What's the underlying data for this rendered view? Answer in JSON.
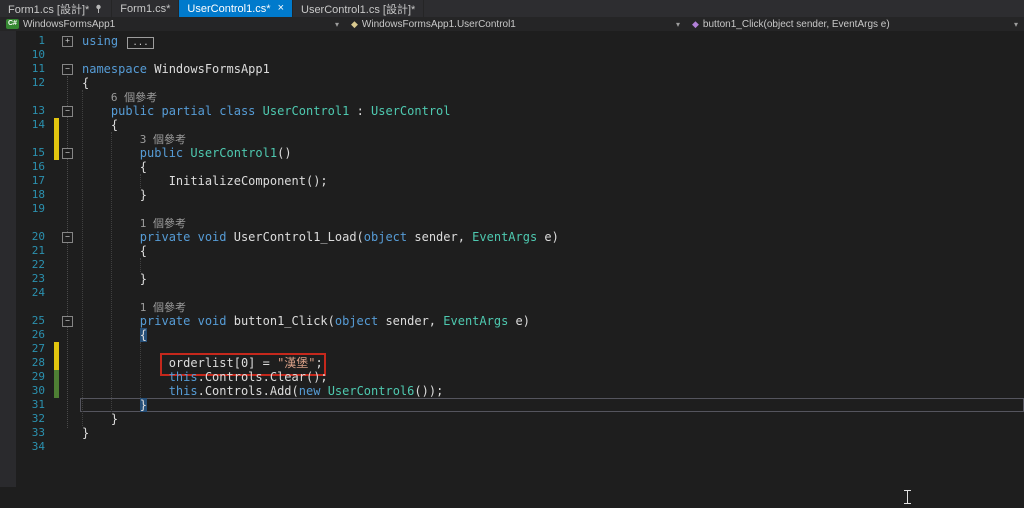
{
  "tabs": [
    {
      "label": "Form1.cs [設計]*",
      "state": "inactive",
      "pinned": true
    },
    {
      "label": "Form1.cs*",
      "state": "inactive"
    },
    {
      "label": "UserControl1.cs*",
      "state": "active",
      "closable": true
    },
    {
      "label": "UserControl1.cs [設計]*",
      "state": "inactive"
    }
  ],
  "navbar": {
    "project": "WindowsFormsApp1",
    "type": "WindowsFormsApp1.UserControl1",
    "member": "button1_Click(object sender, EventArgs e)"
  },
  "icons": {
    "close": "×",
    "chevron": "▾",
    "project": "C#",
    "class": "◆",
    "method": "◆",
    "collapse": "−",
    "expand": "+"
  },
  "colors": {
    "accent": "#007ACC",
    "background": "#1E1E1E",
    "keyword": "#569CD6",
    "type": "#4EC9B0",
    "string": "#D69D85",
    "text": "#DCDCDC",
    "line_number": "#2B91AF",
    "codelens": "#9D9D9D",
    "change_unsaved": "#E2C50F",
    "change_saved": "#4E7F34",
    "annotation_red": "#C5281C",
    "brace_match": "#264F78"
  },
  "editor": {
    "rows": [
      {
        "n": "1",
        "fold": "+",
        "segs": [
          [
            "k",
            "using"
          ],
          [
            "p",
            " "
          ],
          [
            "dots",
            "..."
          ]
        ]
      },
      {
        "n": "10",
        "segs": []
      },
      {
        "n": "11",
        "fold": "-",
        "segs": [
          [
            "k",
            "namespace"
          ],
          [
            "p",
            " WindowsFormsApp1"
          ]
        ]
      },
      {
        "n": "12",
        "segs": [
          [
            "p",
            "{"
          ]
        ]
      },
      {
        "lens": "6 個參考",
        "col": 4
      },
      {
        "n": "13",
        "fold": "-",
        "segs": [
          [
            "p",
            "    "
          ],
          [
            "k",
            "public partial class"
          ],
          [
            "p",
            " "
          ],
          [
            "t",
            "UserControl1"
          ],
          [
            "p",
            " : "
          ],
          [
            "t",
            "UserControl"
          ]
        ]
      },
      {
        "n": "14",
        "change": "y",
        "segs": [
          [
            "p",
            "    {"
          ]
        ]
      },
      {
        "lens": "3 個參考",
        "col": 8,
        "change": "y"
      },
      {
        "n": "15",
        "fold": "-",
        "change": "y",
        "segs": [
          [
            "p",
            "        "
          ],
          [
            "k",
            "public"
          ],
          [
            "p",
            " "
          ],
          [
            "t",
            "UserControl1"
          ],
          [
            "p",
            "()"
          ]
        ]
      },
      {
        "n": "16",
        "segs": [
          [
            "p",
            "        {"
          ]
        ]
      },
      {
        "n": "17",
        "segs": [
          [
            "p",
            "            InitializeComponent();"
          ]
        ]
      },
      {
        "n": "18",
        "segs": [
          [
            "p",
            "        }"
          ]
        ]
      },
      {
        "n": "19",
        "segs": []
      },
      {
        "lens": "1 個參考",
        "col": 8
      },
      {
        "n": "20",
        "fold": "-",
        "segs": [
          [
            "p",
            "        "
          ],
          [
            "k",
            "private void"
          ],
          [
            "p",
            " UserControl1_Load("
          ],
          [
            "k",
            "object"
          ],
          [
            "p",
            " sender, "
          ],
          [
            "t",
            "EventArgs"
          ],
          [
            "p",
            " e)"
          ]
        ]
      },
      {
        "n": "21",
        "segs": [
          [
            "p",
            "        {"
          ]
        ]
      },
      {
        "n": "22",
        "segs": []
      },
      {
        "n": "23",
        "segs": [
          [
            "p",
            "        }"
          ]
        ]
      },
      {
        "n": "24",
        "segs": []
      },
      {
        "lens": "1 個參考",
        "col": 8
      },
      {
        "n": "25",
        "fold": "-",
        "segs": [
          [
            "p",
            "        "
          ],
          [
            "k",
            "private void"
          ],
          [
            "p",
            " button1_Click("
          ],
          [
            "k",
            "object"
          ],
          [
            "p",
            " sender, "
          ],
          [
            "t",
            "EventArgs"
          ],
          [
            "p",
            " e)"
          ]
        ]
      },
      {
        "n": "26",
        "segs": [
          [
            "p",
            "        "
          ],
          [
            "b",
            "{"
          ]
        ]
      },
      {
        "n": "27",
        "change": "y",
        "segs": []
      },
      {
        "n": "28",
        "change": "y",
        "redbox": true,
        "segs": [
          [
            "p",
            "            orderlist[0] = "
          ],
          [
            "s",
            "\"漢堡\""
          ],
          [
            "p",
            ";"
          ]
        ]
      },
      {
        "n": "29",
        "change": "g",
        "segs": [
          [
            "p",
            "            "
          ],
          [
            "k",
            "this"
          ],
          [
            "p",
            ".Controls.Clear();"
          ]
        ]
      },
      {
        "n": "30",
        "change": "g",
        "segs": [
          [
            "p",
            "            "
          ],
          [
            "k",
            "this"
          ],
          [
            "p",
            ".Controls.Add("
          ],
          [
            "k",
            "new"
          ],
          [
            "p",
            " "
          ],
          [
            "t",
            "UserControl6"
          ],
          [
            "p",
            "());"
          ]
        ]
      },
      {
        "n": "31",
        "current": true,
        "segs": [
          [
            "p",
            "        "
          ],
          [
            "b",
            "}"
          ]
        ]
      },
      {
        "n": "32",
        "segs": [
          [
            "p",
            "    }"
          ]
        ]
      },
      {
        "n": "33",
        "segs": [
          [
            "p",
            "}"
          ]
        ]
      },
      {
        "n": "34",
        "segs": []
      }
    ],
    "guides": [
      {
        "col": 0,
        "from": 4,
        "to": 27
      },
      {
        "col": 4,
        "from": 7,
        "to": 26
      },
      {
        "col": 8,
        "from": 10,
        "to": 10
      },
      {
        "col": 8,
        "from": 16,
        "to": 16
      },
      {
        "col": 8,
        "from": 22,
        "to": 25
      }
    ]
  }
}
